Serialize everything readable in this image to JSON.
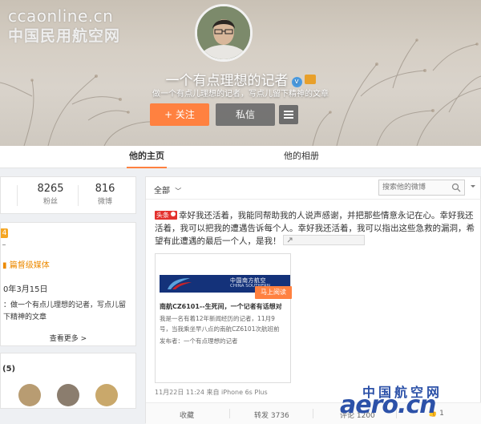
{
  "watermark": {
    "url": "ccaonline.cn",
    "site_name": "中国民用航空网",
    "logo_cn": "中国航空网",
    "logo_en": "aero.cn"
  },
  "profile": {
    "name": "一个有点理想的记者",
    "bio": "做一个有点儿理想的记者，写点儿留下精神的文章",
    "follow_label": "+ 关注",
    "message_label": "私信",
    "more_icon": "menu-icon"
  },
  "tabs": [
    {
      "label": "他的主页",
      "active": true
    },
    {
      "label": "他的相册",
      "active": false
    }
  ],
  "stats": {
    "followers": "8265",
    "followers_label": "粉丝",
    "weibo": "816",
    "weibo_label": "微博"
  },
  "info": {
    "level": "4",
    "tag": "篇督级媒体",
    "date": "0年3月15日",
    "intro": "：做一个有点儿理想的记者，写点儿留下精神的文章",
    "see_more": "查看更多 >"
  },
  "following": {
    "title": "(5)"
  },
  "feed": {
    "filter_label": "全部",
    "search_placeholder": "搜索他的微博",
    "post": {
      "tag": "头条",
      "text": "幸好我还活着，我能同帮助我的人说声感谢，并把那些情意永记在心。幸好我还活着，我可以把我的遭遇告诉每个人。幸好我还活着，我可以指出这些急救的漏洞，希望有此遭遇的最后一个人，是我！",
      "article": {
        "banner_cn": "中国南方航空",
        "banner_en": "CHINA SOUTHERN",
        "title": "南航CZ6101--生死间，一个记者有话想对",
        "desc": "我是一名有着12年新闻经历的记者，11月9号，当我乘坐早八点的南航CZ6101次航班前",
        "author": "发布者：一个有点理想的记者",
        "read_button": "马上阅读"
      },
      "meta": "11月22日 11:24 来自 iPhone 6s Plus",
      "actions": {
        "favorite": "收藏",
        "repost": "转发 3736",
        "comment": "评论 1200",
        "like": "1"
      }
    }
  },
  "colors": {
    "accent": "#ff8140",
    "cover_bg": "#d6cfc5",
    "link_blue": "#2c51a8"
  }
}
